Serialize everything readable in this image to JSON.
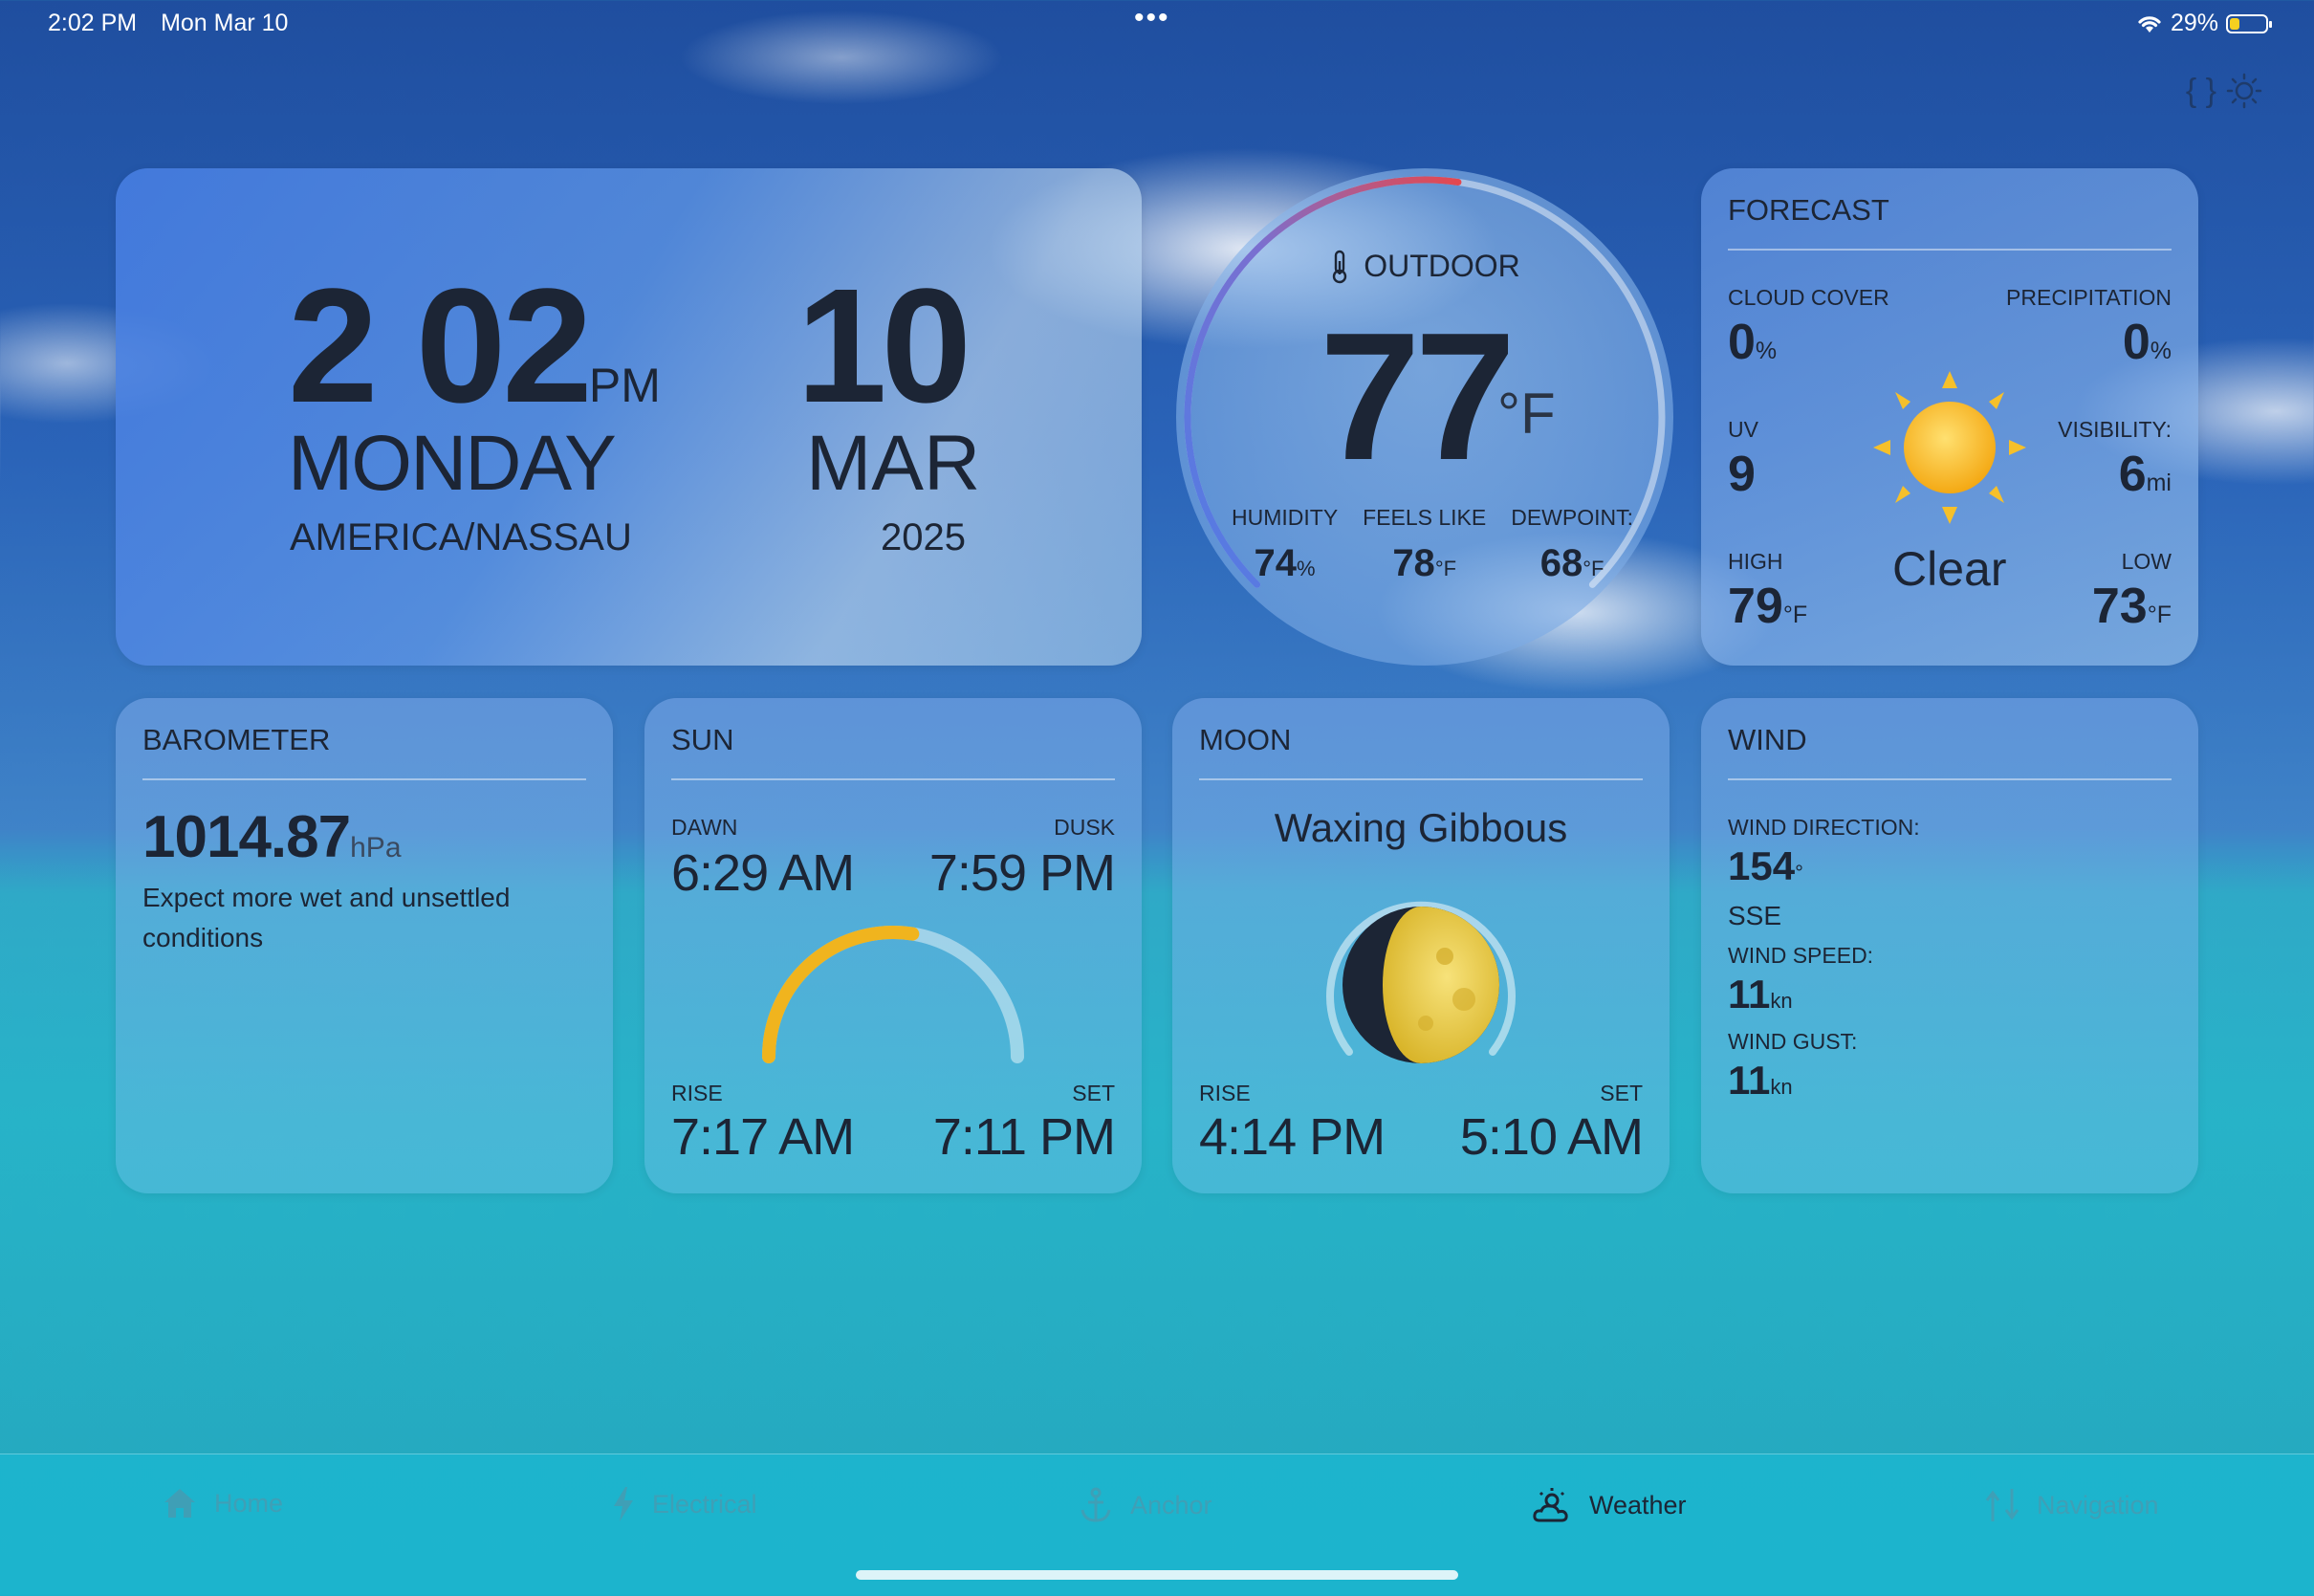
{
  "status_bar": {
    "time": "2:02 PM",
    "date": "Mon Mar 10",
    "battery": "29%",
    "battery_level": 0.29
  },
  "clock": {
    "time": "2 02",
    "ampm": "PM",
    "day": "MONDAY",
    "timezone": "AMERICA/NASSAU",
    "date": "10",
    "month": "MAR",
    "year": "2025"
  },
  "outdoor": {
    "label": "OUTDOOR",
    "temp": "77",
    "unit": "°F",
    "temp_range_fraction": 0.53,
    "humidity": {
      "label": "HUMIDITY",
      "value": "74",
      "unit": "%"
    },
    "feels_like": {
      "label": "FEELS LIKE",
      "value": "78",
      "unit": "°F"
    },
    "dewpoint": {
      "label": "DEWPOINT:",
      "value": "68",
      "unit": "°F"
    }
  },
  "forecast": {
    "title": "FORECAST",
    "cloud_cover": {
      "label": "CLOUD COVER",
      "value": "0",
      "unit": "%"
    },
    "precipitation": {
      "label": "PRECIPITATION",
      "value": "0",
      "unit": "%"
    },
    "uv": {
      "label": "UV",
      "value": "9"
    },
    "visibility": {
      "label": "VISIBILITY:",
      "value": "6",
      "unit": "mi"
    },
    "high": {
      "label": "HIGH",
      "value": "79",
      "unit": "°F"
    },
    "low": {
      "label": "LOW",
      "value": "73",
      "unit": "°F"
    },
    "condition": "Clear",
    "icon": "sun-icon"
  },
  "barometer": {
    "title": "BAROMETER",
    "value": "1014.87",
    "unit": "hPa",
    "description": "Expect more wet and unsettled conditions"
  },
  "sun": {
    "title": "SUN",
    "dawn_label": "DAWN",
    "dawn": "6:29 AM",
    "dusk_label": "DUSK",
    "dusk": "7:59 PM",
    "rise_label": "RISE",
    "rise": "7:17 AM",
    "set_label": "SET",
    "set": "7:11 PM",
    "day_progress": 0.55
  },
  "moon": {
    "title": "MOON",
    "phase": "Waxing Gibbous",
    "rise_label": "RISE",
    "rise": "4:14 PM",
    "set_label": "SET",
    "set": "5:10 AM"
  },
  "wind": {
    "title": "WIND",
    "direction_label": "WIND DIRECTION:",
    "direction": "154",
    "direction_unit": "°",
    "direction_cardinal": "SSE",
    "speed_label": "WIND SPEED:",
    "speed": "11",
    "speed_unit": "kn",
    "gust_label": "WIND GUST:",
    "gust": "11",
    "gust_unit": "kn"
  },
  "tabs": [
    {
      "label": "Home",
      "icon": "house-icon",
      "active": false
    },
    {
      "label": "Electrical",
      "icon": "bolt-icon",
      "active": false
    },
    {
      "label": "Anchor",
      "icon": "anchor-icon",
      "active": false
    },
    {
      "label": "Weather",
      "icon": "weather-icon",
      "active": true
    },
    {
      "label": "Navigation",
      "icon": "navigation-icon",
      "active": false
    }
  ],
  "colors": {
    "accent_sun": "#f0b41e",
    "temp_arc_cold": "#5a7fe0",
    "temp_arc_hot": "#e4484f"
  }
}
